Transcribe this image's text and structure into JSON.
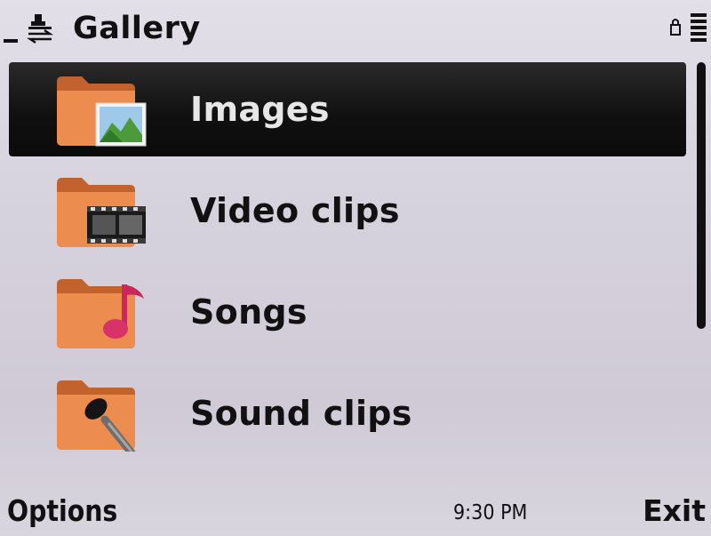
{
  "header": {
    "title": "Gallery",
    "network_icon": "data-transfer-icon",
    "lock_icon": "keylock-icon",
    "battery_icon": "battery-icon"
  },
  "list": {
    "items": [
      {
        "label": "Images",
        "icon": "images-folder-icon",
        "selected": true
      },
      {
        "label": "Video clips",
        "icon": "video-folder-icon",
        "selected": false
      },
      {
        "label": "Songs",
        "icon": "music-folder-icon",
        "selected": false
      },
      {
        "label": "Sound clips",
        "icon": "sound-folder-icon",
        "selected": false
      }
    ]
  },
  "softkeys": {
    "left": "Options",
    "right": "Exit"
  },
  "status": {
    "time": "9:30 PM"
  },
  "colors": {
    "highlight": "#111111",
    "folder": "#e8874a",
    "background": "#d6d2dd"
  }
}
